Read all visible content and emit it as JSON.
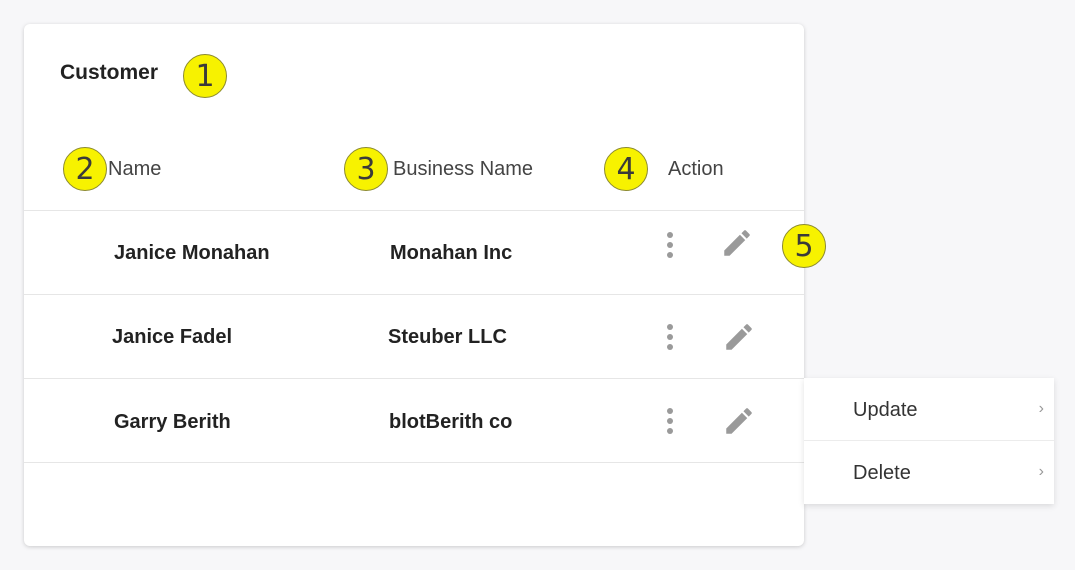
{
  "card": {
    "title": "Customer"
  },
  "table": {
    "headers": {
      "name": "Name",
      "business_name": "Business Name",
      "action": "Action"
    },
    "rows": [
      {
        "name": "Janice Monahan",
        "business_name": "Monahan Inc"
      },
      {
        "name": "Janice Fadel",
        "business_name": "Steuber LLC"
      },
      {
        "name": "Garry Berith",
        "business_name": "blotBerith co"
      }
    ]
  },
  "context_menu": {
    "items": [
      {
        "label": "Update",
        "chevron": "›"
      },
      {
        "label": "Delete",
        "chevron": "›"
      }
    ]
  },
  "annotations": [
    "1",
    "2",
    "3",
    "4",
    "5"
  ],
  "icons": {
    "row_more": "more-vertical-icon",
    "row_edit": "pencil-icon"
  },
  "colors": {
    "annotation_fill": "#f7f200",
    "icon_gray": "#9a9a9a"
  }
}
